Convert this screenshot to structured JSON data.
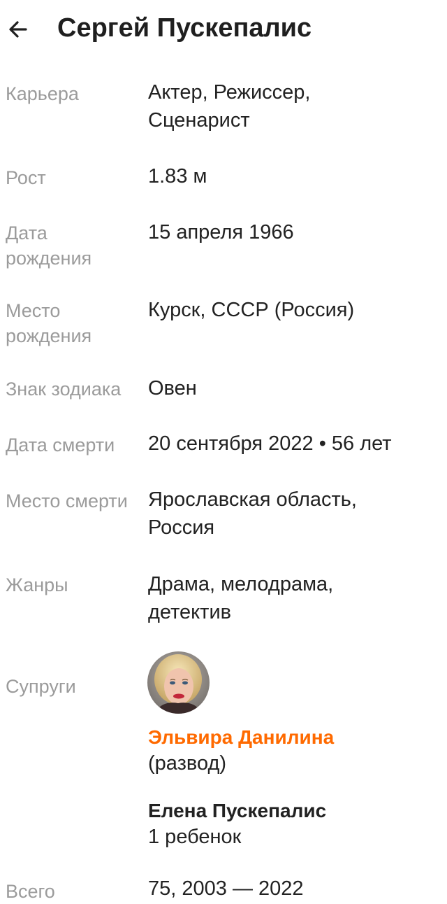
{
  "header": {
    "title": "Сергей Пускепалис",
    "back_icon": "arrow-left-icon"
  },
  "details": [
    {
      "label": "Карьера",
      "value": "Актер, Режиссер, Сценарист"
    },
    {
      "label": "Рост",
      "value": "1.83 м"
    },
    {
      "label": "Дата рождения",
      "value": "15 апреля 1966"
    },
    {
      "label": "Место рождения",
      "value": "Курск, СССР (Россия)"
    },
    {
      "label": "Знак зодиака",
      "value": "Овен"
    },
    {
      "label": "Дата смерти",
      "value": "20 сентября 2022 • 56 лет"
    },
    {
      "label": "Место смерти",
      "value": "Ярославская область, Россия"
    },
    {
      "label": "Жанры",
      "value": "Драма, мелодрама, детектив"
    }
  ],
  "spouses": {
    "label": "Супруги",
    "items": [
      {
        "name": "Эльвира Данилина",
        "note": "(развод)",
        "has_photo": true,
        "is_link": true
      },
      {
        "name": "Елена Пускепалис",
        "note": "1 ребенок",
        "has_photo": false,
        "is_link": false
      }
    ]
  },
  "partial_row": {
    "label": "Всего",
    "value": "75, 2003 — 2022"
  },
  "colors": {
    "accent": "#ff6a00",
    "label_gray": "#9b9b9b",
    "text": "#222222"
  }
}
